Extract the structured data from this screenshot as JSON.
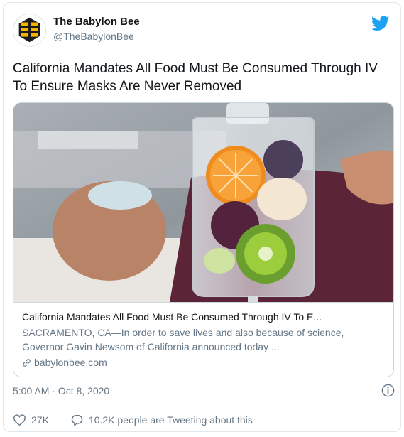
{
  "account": {
    "name": "The Babylon Bee",
    "handle": "@TheBabylonBee",
    "avatar_icon": "bee-logo-icon",
    "brand_colors": {
      "bee_yellow": "#f5b400",
      "bee_black": "#1b1b1b",
      "twitter_blue": "#1da1f2"
    }
  },
  "tweet": {
    "text": "California Mandates All Food Must Be Consumed Through IV To Ensure Masks Are Never Removed"
  },
  "card": {
    "image_icon": "iv-bag-fruit-photo",
    "title": "California Mandates All Food Must Be Consumed Through IV To E...",
    "description": "SACRAMENTO, CA—In order to save lives and also because of science, Governor Gavin Newsom of California announced today ...",
    "domain": "babylonbee.com",
    "link_icon": "link-icon"
  },
  "meta": {
    "timestamp": "5:00 AM · Oct 8, 2020",
    "info_icon": "info-icon"
  },
  "actions": {
    "likes": "27K",
    "like_icon": "heart-icon",
    "conversation": "10.2K people are Tweeting about this",
    "conversation_icon": "reply-bubble-icon"
  }
}
